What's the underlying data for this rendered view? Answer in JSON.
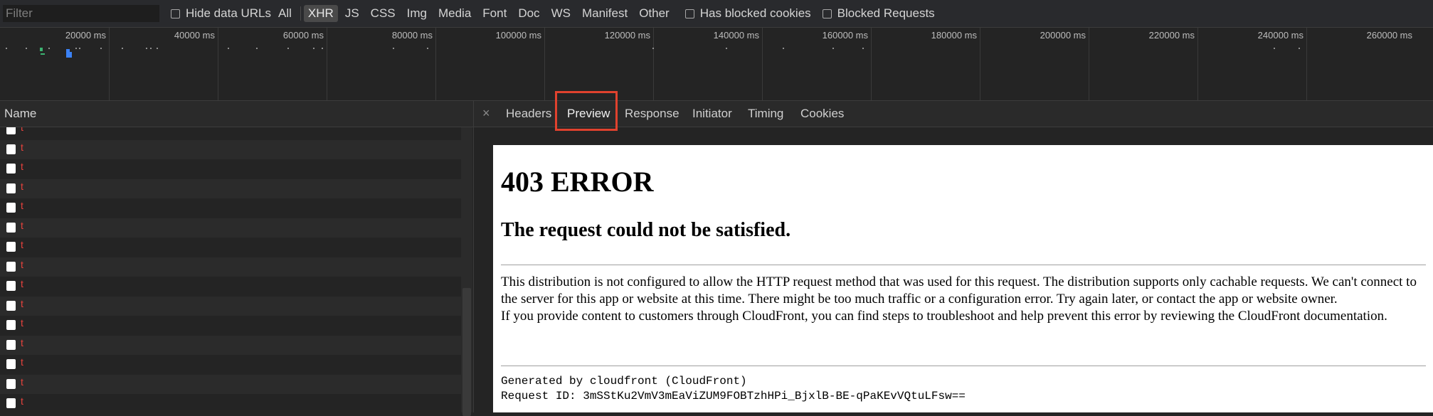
{
  "toolbar": {
    "filter_placeholder": "Filter",
    "hide_data_urls": "Hide data URLs",
    "types": [
      "All",
      "XHR",
      "JS",
      "CSS",
      "Img",
      "Media",
      "Font",
      "Doc",
      "WS",
      "Manifest",
      "Other"
    ],
    "active_type": "XHR",
    "has_blocked_cookies": "Has blocked cookies",
    "blocked_requests": "Blocked Requests"
  },
  "overview": {
    "ticks": [
      "20000 ms",
      "40000 ms",
      "60000 ms",
      "80000 ms",
      "100000 ms",
      "120000 ms",
      "140000 ms",
      "160000 ms",
      "180000 ms",
      "200000 ms",
      "220000 ms",
      "240000 ms",
      "260000 ms"
    ]
  },
  "request_list": {
    "header": "Name",
    "rows": [
      "t",
      "t",
      "t",
      "t",
      "t",
      "t",
      "t",
      "t",
      "t",
      "t",
      "t",
      "t",
      "t",
      "t",
      "t"
    ]
  },
  "details": {
    "close": "×",
    "tabs": [
      "Headers",
      "Preview",
      "Response",
      "Initiator",
      "Timing",
      "Cookies"
    ],
    "selected_tab": "Preview",
    "preview": {
      "h1": "403 ERROR",
      "h2": "The request could not be satisfied.",
      "p1": "This distribution is not configured to allow the HTTP request method that was used for this request. The distribution supports only cachable requests. We can't connect to the server for this app or website at this time. There might be too much traffic or a configuration error. Try again later, or contact the app or website owner.",
      "p2": "If you provide content to customers through CloudFront, you can find steps to troubleshoot and help prevent this error by reviewing the CloudFront documentation.",
      "generated_by": "Generated by cloudfront (CloudFront)",
      "request_id": "Request ID: 3mSStKu2VmV3mEaViZUM9FOBTzhHPi_BjxlB-BE-qPaKEvVQtuLFsw=="
    }
  },
  "colors": {
    "highlight": "#e0422e",
    "row_name": "#e6423c"
  }
}
